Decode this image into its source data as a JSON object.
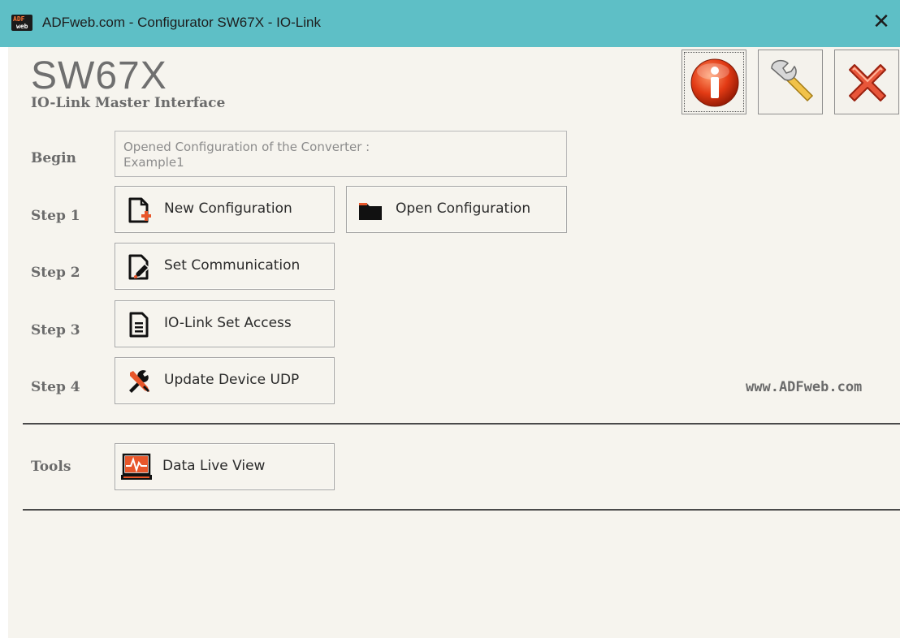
{
  "window": {
    "title": "ADFweb.com - Configurator SW67X - IO-Link",
    "logo_top": "ADF",
    "logo_bottom": "web",
    "close_glyph": "✕"
  },
  "header": {
    "product": "SW67X",
    "subtitle": "IO-Link Master Interface"
  },
  "toolbar": {
    "info_icon": "info-icon",
    "settings_icon": "wrench-icon",
    "exit_icon": "red-x-icon"
  },
  "steps": {
    "begin_label": "Begin",
    "begin_info_line1": "Opened Configuration of the Converter :",
    "begin_info_line2": "Example1",
    "step1_label": "Step 1",
    "step2_label": "Step 2",
    "step3_label": "Step 3",
    "step4_label": "Step 4",
    "tools_label": "Tools"
  },
  "buttons": {
    "new_config": "New Configuration",
    "open_config": "Open Configuration",
    "set_comm": "Set Communication",
    "io_link_access": "IO-Link Set Access",
    "update_device": "Update Device UDP",
    "data_live_view": "Data Live View"
  },
  "website": "www.ADFweb.com",
  "colors": {
    "titlebar": "#5ebfc6",
    "background": "#f6f4ee",
    "accent_orange": "#e8562a"
  }
}
